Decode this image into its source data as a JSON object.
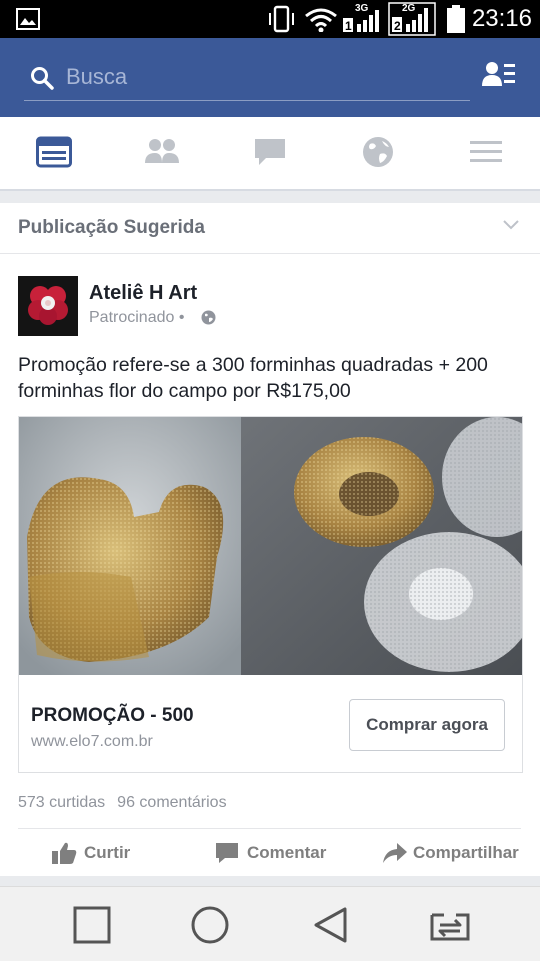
{
  "status_bar": {
    "time": "23:16",
    "sim1_network": "3G",
    "sim2_network": "2G",
    "icons": [
      "gallery-icon",
      "vibrate-icon",
      "wifi-icon",
      "sim1-signal-icon",
      "sim2-signal-icon",
      "battery-icon"
    ]
  },
  "header": {
    "search_placeholder": "Busca",
    "icons": [
      "search-icon",
      "profile-menu-icon"
    ]
  },
  "tabs": [
    {
      "name": "news-feed",
      "icon": "news-feed-icon",
      "active": true
    },
    {
      "name": "friends",
      "icon": "friends-icon",
      "active": false
    },
    {
      "name": "messages",
      "icon": "chat-bubble-icon",
      "active": false
    },
    {
      "name": "notifications",
      "icon": "globe-icon",
      "active": false
    },
    {
      "name": "menu",
      "icon": "hamburger-icon",
      "active": false
    }
  ],
  "section": {
    "title": "Publicação Sugerida"
  },
  "post": {
    "page_name": "Ateliê H Art",
    "sponsored": "Patrocinado •",
    "text": "Promoção refere-se a 300 forminhas quadradas + 200 forminhas flor do campo por R$175,00",
    "ad": {
      "title": "PROMOÇÃO - 500",
      "url": "www.elo7.com.br",
      "cta": "Comprar agora"
    },
    "stats": {
      "likes": "573 curtidas",
      "comments": "96 comentários"
    },
    "actions": {
      "like": "Curtir",
      "comment": "Comentar",
      "share": "Compartilhar"
    }
  },
  "nav_bar": {
    "icons": [
      "recent-apps-icon",
      "home-icon",
      "back-icon",
      "dual-window-icon"
    ]
  },
  "colors": {
    "brand": "#3b5998",
    "background": "#e9ebee",
    "text": "#1d2129",
    "secondary_text": "#90949c"
  }
}
